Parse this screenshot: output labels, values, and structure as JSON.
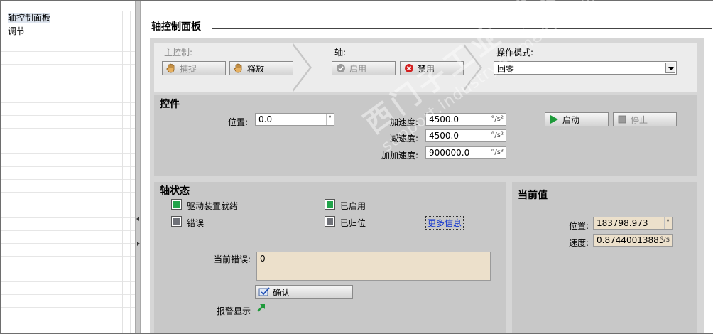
{
  "tree": {
    "items": [
      {
        "label": "轴控制面板",
        "selected": true
      },
      {
        "label": "调节",
        "selected": false
      }
    ]
  },
  "main": {
    "title": "轴控制面板"
  },
  "master": {
    "label": "主控制:",
    "capture_label": "捕捉",
    "release_label": "释放"
  },
  "axis": {
    "label": "轴:",
    "enable_label": "启用",
    "disable_label": "禁用"
  },
  "mode": {
    "label": "操作模式:",
    "selected": "回零"
  },
  "controls": {
    "title": "控件",
    "position_label": "位置:",
    "position_value": "0.0",
    "position_unit": "°",
    "accel_label": "加速度:",
    "accel_value": "4500.0",
    "accel_unit": "°/s²",
    "decel_label": "减速度:",
    "decel_value": "4500.0",
    "decel_unit": "°/s²",
    "jerk_label": "加加速度:",
    "jerk_value": "900000.0",
    "jerk_unit": "°/s³",
    "start_label": "启动",
    "stop_label": "停止"
  },
  "status": {
    "title": "轴状态",
    "drive_ready_label": "驱动装置就绪",
    "drive_ready_on": true,
    "enabled_label": "已启用",
    "enabled_on": true,
    "error_label": "错误",
    "error_on": false,
    "homed_label": "已归位",
    "homed_on": false,
    "more_info_label": "更多信息",
    "current_error_label": "当前错误:",
    "current_error_value": "0",
    "confirm_label": "确认",
    "alarm_label": "报警显示"
  },
  "current": {
    "title": "当前值",
    "position_label": "位置:",
    "position_value": "183798.973",
    "position_unit": "°",
    "speed_label": "速度:",
    "speed_value": "0.87440013885",
    "speed_unit": "°/s"
  },
  "watermark": {
    "line1": "西门子工业 答案",
    "line2": "support.industry.siemens.com/cs"
  },
  "colors": {
    "led_on": "#21a34a",
    "led_off": "#6f7178",
    "link": "#0a2fcf",
    "readonly_field": "#ece0cb"
  }
}
